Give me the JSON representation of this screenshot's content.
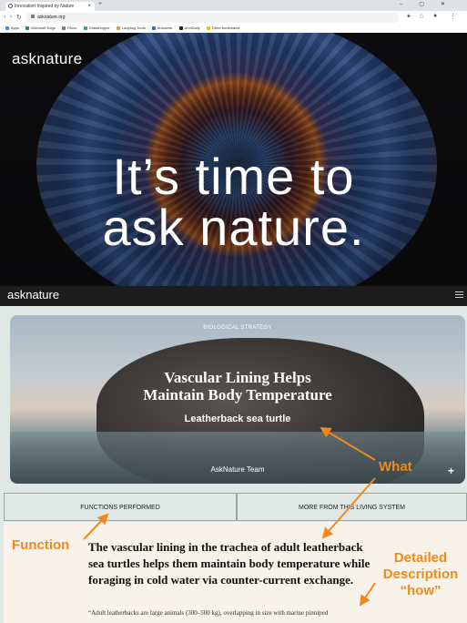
{
  "browser": {
    "tab_title": "Innovation Inspired by Nature",
    "omnibox_url": "asknature.org",
    "bookmarks": [
      "Apps",
      "Microsoft Edge",
      "Rhino",
      "Grasshopper",
      "Ladybug Tools",
      "Autodesk",
      "ArchDaily",
      "Other bookmarks"
    ],
    "colors": {
      "tabbar": "#dee1e6",
      "omnibox": "#f1f3f4"
    }
  },
  "hero": {
    "logo": "asknature",
    "title_line1": "It’s time to",
    "title_line2": "ask nature."
  },
  "site_header": {
    "logo": "asknature"
  },
  "card": {
    "label": "BIOLOGICAL STRATEGY",
    "title_line1": "Vascular Lining Helps",
    "title_line2": "Maintain Body Temperature",
    "subtitle": "Leatherback sea turtle",
    "author": "AskNature Team",
    "plus_icon": "+"
  },
  "tabs": {
    "functions": "FUNCTIONS PERFORMED",
    "living_system": "MORE FROM THIS LIVING SYSTEM"
  },
  "summary": "The vascular lining in the trachea of adult leatherback sea turtles helps them maintain body temperature while foraging in cold water via counter-current exchange.",
  "quote": "“Adult leatherbacks are large animals (300–500 kg), overlapping in size with marine pinniped",
  "annotations": {
    "what": "What",
    "function": "Function",
    "detail_line1": "Detailed",
    "detail_line2": "Description",
    "detail_line3": "“how”",
    "color": "#f08a1e"
  }
}
